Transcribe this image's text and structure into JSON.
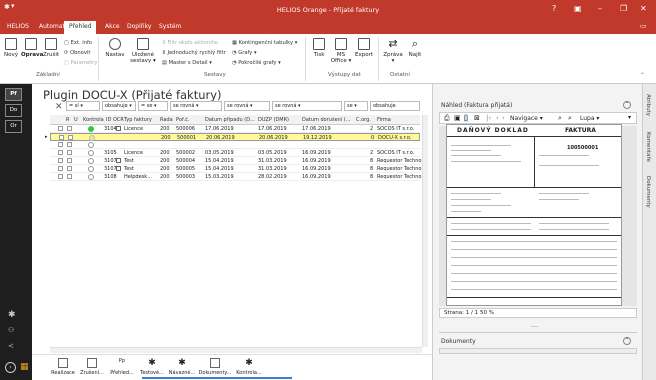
{
  "window": {
    "app_name": "HELIOS",
    "title": "HELIOS Orange - Přijaté faktury",
    "controls": [
      "?",
      "▣",
      "–",
      "❐",
      "✕"
    ]
  },
  "menu": {
    "items": [
      "HELIOS",
      "Automat",
      "Přehled",
      "Akce",
      "Doplňky",
      "Systém"
    ],
    "active": "Přehled"
  },
  "ribbon": {
    "buttons": [
      "Nový",
      "Oprava",
      "Zrušit",
      "Nastav",
      "Uložené sestavy ▾",
      "Tisk",
      "MS Office ▾",
      "Export",
      "Zpráva ▾",
      "Najít"
    ],
    "small_items": [
      "Ext. info",
      "Obnovit",
      "Parametry",
      "Filtr okolo aktivního",
      "Jednoduchý rychlý filtr",
      "Master s Detail ▾",
      "Kontingenční tabulky ▾",
      "Grafy ▾",
      "Pokročilé grafy ▾"
    ],
    "groups": [
      "Základní",
      "Sestavy",
      "Výstupy dat",
      "Ostatní"
    ]
  },
  "leftbar": {
    "items": [
      "Pf",
      "Do",
      "Or"
    ]
  },
  "page": {
    "title": "Plugin DOCU-X (Přijaté faktury)"
  },
  "filters": [
    "= sl ▾",
    "obsahuje ▾",
    "= se ▾",
    "se rovná ▾",
    "se rovná ▾",
    "se rovná ▾",
    "se ▾",
    "obsahuje"
  ],
  "table": {
    "columns": [
      "R",
      "U",
      "Kontrola",
      "ID",
      "OCR",
      "Typ faktury",
      "Řada",
      "Poř.č.",
      "Datum případu (D...",
      "DUZP (DMR)",
      "Datum dorušení (...",
      "C.org.",
      "Firma"
    ],
    "rows": [
      {
        "id": "3104",
        "status": "green",
        "type": "Licence",
        "rada": "200",
        "por": "500006",
        "datum": "17.06.2019",
        "duzp": "17.06.2019",
        "doruc": "17.06.2019",
        "corg": "2",
        "firma": "SOCOS IT s.r.o.",
        "ocr": true,
        "highlight": false
      },
      {
        "id": "",
        "status": "yellow",
        "type": "",
        "rada": "200",
        "por": "500001",
        "datum": "20.06.2019",
        "duzp": "20.06.2019",
        "doruc": "19.12.2019",
        "corg": "0",
        "firma": "DOCU-X s.r.o.",
        "ocr": false,
        "highlight": true
      },
      {
        "id": "",
        "status": "empty",
        "type": "",
        "rada": "",
        "por": "",
        "datum": "",
        "duzp": "",
        "doruc": "",
        "corg": "",
        "firma": "",
        "ocr": false,
        "highlight": false
      },
      {
        "id": "3105",
        "status": "empty",
        "type": "Licence",
        "rada": "200",
        "por": "500002",
        "datum": "03.05.2019",
        "duzp": "03.05.2019",
        "doruc": "16.09.2019",
        "corg": "2",
        "firma": "SOCOS IT s.r.o.",
        "ocr": false,
        "highlight": false
      },
      {
        "id": "3107",
        "status": "empty",
        "type": "Test",
        "rada": "200",
        "por": "500004",
        "datum": "15.04.2019",
        "duzp": "31.03.2019",
        "doruc": "16.09.2019",
        "corg": "8",
        "firma": "Requestor Technolo",
        "ocr": true,
        "highlight": false
      },
      {
        "id": "3107",
        "status": "empty",
        "type": "Test",
        "rada": "200",
        "por": "500005",
        "datum": "15.04.2019",
        "duzp": "31.03.2019",
        "doruc": "16.09.2019",
        "corg": "8",
        "firma": "Requestor Technolo",
        "ocr": true,
        "highlight": false
      },
      {
        "id": "3108",
        "status": "empty",
        "type": "Helpdesk...",
        "rada": "200",
        "por": "500003",
        "datum": "15.03.2019",
        "duzp": "28.02.2019",
        "doruc": "16.09.2019",
        "corg": "8",
        "firma": "Requestor Technolo",
        "ocr": false,
        "highlight": false
      }
    ]
  },
  "bottom_toolbar": {
    "items": [
      "Realizace",
      "Zrušení...",
      "Přehled...",
      "Testové...",
      "Návazné...",
      "Dokumenty...",
      "Kontrola..."
    ]
  },
  "right_panel": {
    "preview_title": "Náhled (Faktura přijatá)",
    "navigation_label": "Navigace ▾",
    "zoom_label": "Lupa ▾",
    "page_indicator": "Strana: 1 / 1",
    "zoom_value": "50 %",
    "documents_title": "Dokumenty",
    "vertical_tabs": [
      "Atributy",
      "Komentáře",
      "Dokumenty"
    ]
  },
  "document": {
    "heading_left": "DAŇOVÝ DOKLAD",
    "heading_right": "FAKTURA",
    "invoice_number": "100500001"
  },
  "colors": {
    "brand_red": "#c0392b",
    "status_green": "#2ecc40",
    "row_highlight": "#fff99a",
    "sidebar_dark": "#1e1e1e"
  }
}
